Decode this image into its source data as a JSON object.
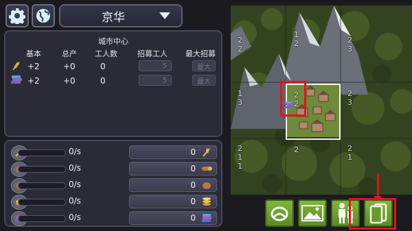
{
  "header": {
    "city_name": "京华",
    "settings_icon": "gear-icon",
    "globe_icon": "globe-icon"
  },
  "city_center": {
    "title": "城市中心",
    "columns": [
      "基本",
      "总产",
      "工人数",
      "招募工人",
      "最大招募"
    ],
    "rows": [
      {
        "icon": "wheat-icon",
        "base": "+2",
        "total": "+0",
        "workers": "0",
        "recruit": "5",
        "max": "最大"
      },
      {
        "icon": "books-icon",
        "base": "+2",
        "total": "+0",
        "workers": "0",
        "recruit": "5",
        "max": "最大"
      }
    ]
  },
  "resources": [
    {
      "icon": "wheat-icon",
      "rate": "0/s",
      "stored": "0"
    },
    {
      "icon": "wood-icon",
      "rate": "0/s",
      "stored": "0"
    },
    {
      "icon": "stone-icon",
      "rate": "0/s",
      "stored": "0"
    },
    {
      "icon": "gold-icon",
      "rate": "0/s",
      "stored": "0"
    },
    {
      "icon": "books-icon",
      "rate": "0/s",
      "stored": "0"
    }
  ],
  "map_tiles": [
    {
      "id": "t00",
      "a": "2",
      "b": "2"
    },
    {
      "id": "t01",
      "a": "1",
      "b": "2"
    },
    {
      "id": "t02",
      "a": "2",
      "b": "3"
    },
    {
      "id": "t10",
      "a": "1",
      "b": "3"
    },
    {
      "id": "t11",
      "a": "2",
      "b": "2"
    },
    {
      "id": "t12",
      "a": "2",
      "b": "3"
    },
    {
      "id": "t20",
      "a": "2",
      "b": "1"
    },
    {
      "id": "t21",
      "a": "2",
      "b": ""
    },
    {
      "id": "t22",
      "a": "2",
      "b": "1"
    },
    {
      "id": "t20c",
      "a": "1",
      "b": ""
    }
  ],
  "toolbar": {
    "ring_icon": "ring-icon",
    "landscape_icon": "landscape-icon",
    "citizens_icon": "citizens-icon",
    "cards_icon": "cards-icon"
  },
  "colors": {
    "highlight": "#e0141a",
    "button_green": "#6f9f30"
  }
}
